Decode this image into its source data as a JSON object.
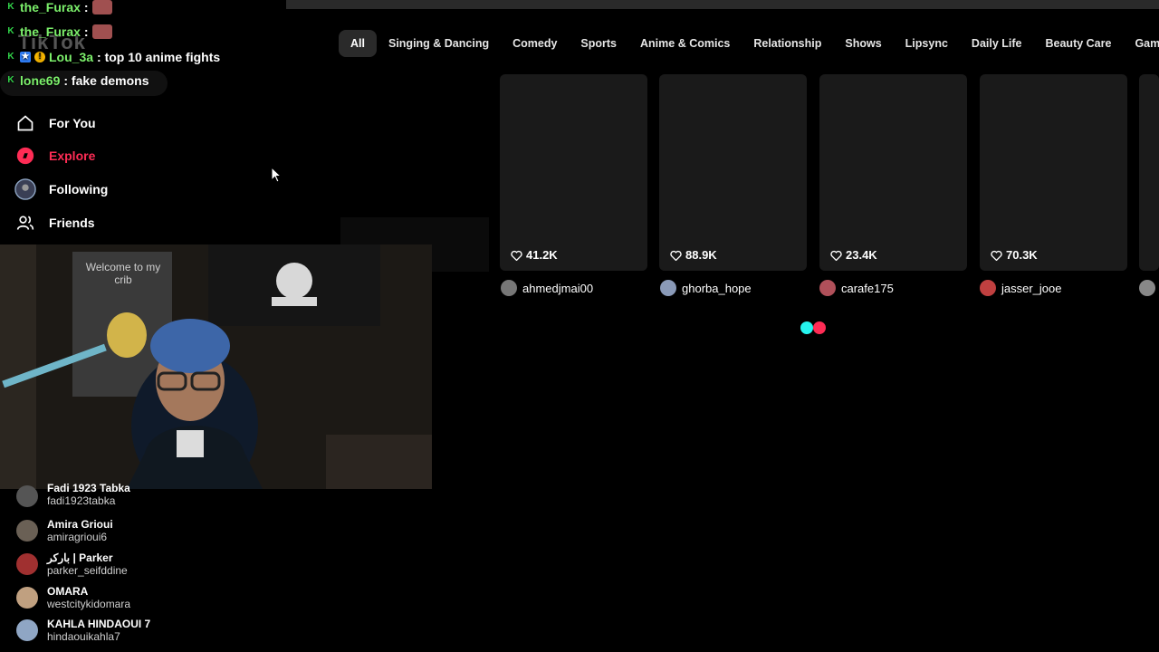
{
  "app": {
    "logo_text": "TikTok"
  },
  "chat": [
    {
      "username": "the_Furax",
      "message": ":"
    },
    {
      "username": "the_Furax",
      "message": ":"
    },
    {
      "username": "Lou_3a",
      "message": ": top 10 anime fights"
    },
    {
      "username": "lone69",
      "message": ": fake demons"
    }
  ],
  "nav": {
    "items": [
      {
        "label": "For You",
        "icon": "home-icon"
      },
      {
        "label": "Explore",
        "icon": "compass-icon",
        "active": true
      },
      {
        "label": "Following",
        "icon": "following-avatar-icon"
      },
      {
        "label": "Friends",
        "icon": "friends-icon"
      }
    ]
  },
  "categories": [
    "All",
    "Singing & Dancing",
    "Comedy",
    "Sports",
    "Anime & Comics",
    "Relationship",
    "Shows",
    "Lipsync",
    "Daily Life",
    "Beauty Care",
    "Games"
  ],
  "videos": [
    {
      "likes": "41.2K",
      "author": "ahmedjmai00"
    },
    {
      "likes": "88.9K",
      "author": "ghorba_hope"
    },
    {
      "likes": "23.4K",
      "author": "carafe175"
    },
    {
      "likes": "70.3K",
      "author": "jasser_jooe"
    }
  ],
  "webcam": {
    "poster_text": "Welcome to my crib"
  },
  "following_accounts": [
    {
      "name": "Fadi 1923 Tabka",
      "username": "fadi1923tabka"
    },
    {
      "name": "Amira Grioui",
      "username": "amiragrioui6"
    },
    {
      "name": "باركر | Parker",
      "username": "parker_seifddine"
    },
    {
      "name": "OMARA",
      "username": "westcitykidomara"
    },
    {
      "name": "KAHLA HINDAOUI 7",
      "username": "hindaouikahla7"
    }
  ],
  "colors": {
    "accent": "#fe2c55",
    "loader_cyan": "#25f4ee",
    "loader_pink": "#fe2c55",
    "card_bg": "#1a1a1a",
    "chat_username": "#7cf06b"
  }
}
